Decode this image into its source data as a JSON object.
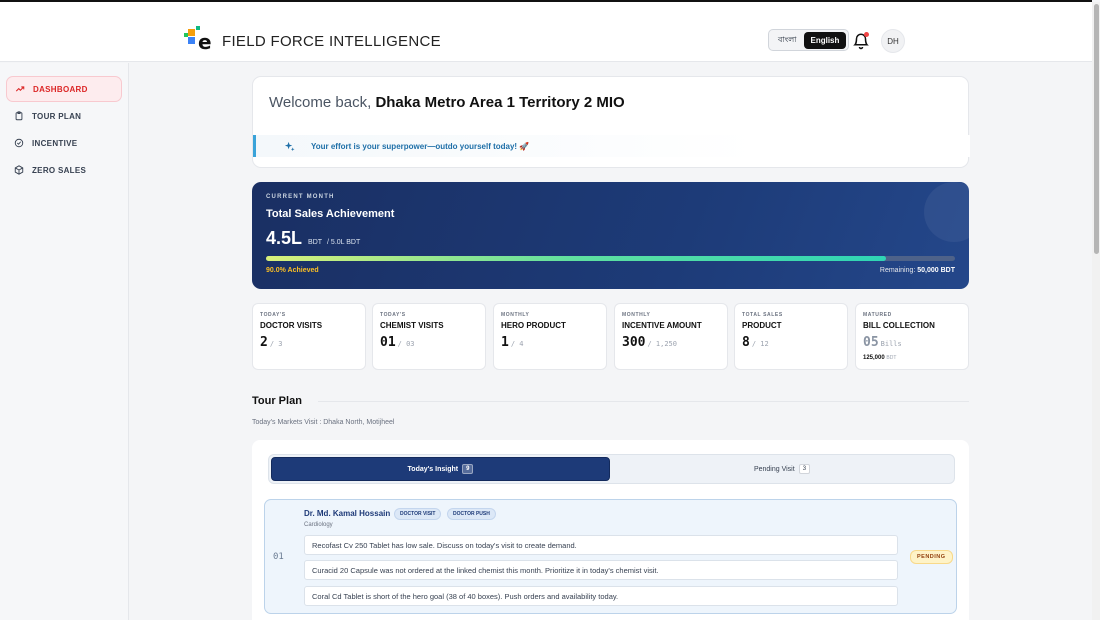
{
  "header": {
    "brand": "FIELD FORCE INTELLIGENCE",
    "lang_bn": "বাংলা",
    "lang_en": "English",
    "avatar": "DH"
  },
  "sidebar": {
    "items": [
      {
        "label": "DASHBOARD",
        "icon": "trend-up-icon",
        "active": true
      },
      {
        "label": "TOUR PLAN",
        "icon": "clipboard-icon",
        "active": false
      },
      {
        "label": "INCENTIVE",
        "icon": "check-circle-icon",
        "active": false
      },
      {
        "label": "ZERO SALES",
        "icon": "box-icon",
        "active": false
      }
    ]
  },
  "welcome": {
    "prefix": "Welcome back, ",
    "name": "Dhaka Metro Area 1 Territory 2 MIO",
    "motivation": "Your effort is your superpower—outdo yourself today! 🚀"
  },
  "sales": {
    "label": "CURRENT MONTH",
    "title": "Total Sales Achievement",
    "value": "4.5L",
    "unit": "BDT",
    "target": "/  5.0L BDT",
    "progress": 0.9,
    "achieved": "90.0% Achieved",
    "remaining_label": "Remaining: ",
    "remaining_value": "50,000 BDT"
  },
  "stats": [
    {
      "top": "TODAY'S",
      "title": "DOCTOR VISITS",
      "value": "2",
      "sub": "/ 3"
    },
    {
      "top": "TODAY'S",
      "title": "CHEMIST VISITS",
      "value": "01",
      "sub": "/ 03"
    },
    {
      "top": "MONTHLY",
      "title": "HERO PRODUCT",
      "value": "1",
      "sub": "/ 4"
    },
    {
      "top": "MONTHLY",
      "title": "INCENTIVE AMOUNT",
      "value": "300",
      "sub": "/ 1,250"
    },
    {
      "top": "TOTAL SALES",
      "title": "PRODUCT",
      "value": "8",
      "sub": "/ 12"
    },
    {
      "top": "MATURED",
      "title": "BILL COLLECTION",
      "value": "05",
      "sub": "Bills",
      "extra": "125,000",
      "extra_unit": "BDT"
    }
  ],
  "tour_plan": {
    "title": "Tour Plan",
    "markets": "Today's Markets Visit : Dhaka North, Motijheel",
    "tab_active": "Today's Insight",
    "tab_active_count": "9",
    "tab_inactive": "Pending Visit",
    "tab_inactive_count": "3",
    "visit": {
      "number": "01",
      "name": "Dr. Md. Kamal Hossain",
      "tag1": "DOCTOR VISIT",
      "tag2": "DOCTOR PUSH",
      "specialty": "Cardiology",
      "status": "PENDING",
      "insights": [
        "Recofast Cv 250 Tablet has low sale. Discuss on today's visit to create demand.",
        "Curacid 20 Capsule was not ordered at the linked chemist this month. Prioritize it in today's chemist visit.",
        "Coral Cd Tablet is short of the hero goal (38 of 40 boxes). Push orders and availability today."
      ]
    }
  },
  "colors": {
    "accent_red": "#dc2626",
    "navy": "#1d3a78",
    "info_blue": "#1e6fa8",
    "achieved_yellow": "#fbbf24"
  }
}
